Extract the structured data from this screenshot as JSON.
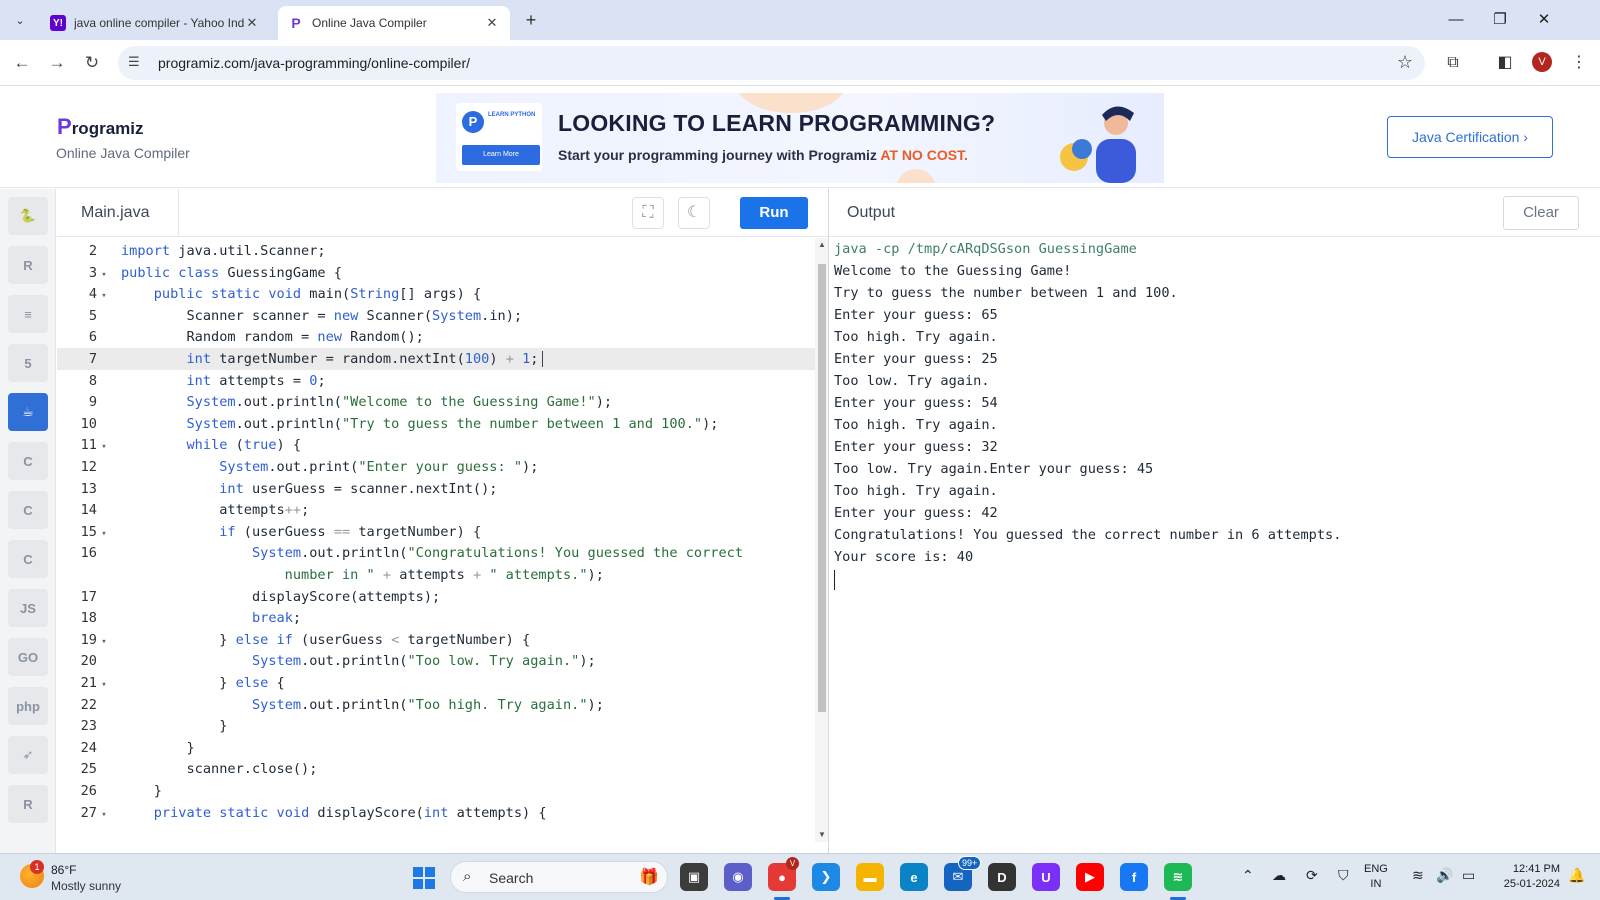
{
  "browser": {
    "tabs": [
      {
        "title": "java online compiler - Yahoo Ind",
        "favicon": "Y!",
        "favicon_color": "#6001d2",
        "close": "✕"
      },
      {
        "title": "Online Java Compiler",
        "favicon": "P",
        "favicon_color": "#ffffff",
        "close": "✕"
      }
    ],
    "tab_dropdown_icon": "⌄",
    "new_tab_icon": "+",
    "window_controls": {
      "minimize": "—",
      "maximize": "❐",
      "close": "✕"
    },
    "nav": {
      "back": "←",
      "forward": "→",
      "reload": "↻"
    },
    "url": "programiz.com/java-programming/online-compiler/",
    "site_info_icon": "☰",
    "bookmark_icon": "☆",
    "extensions_icon": "⧉",
    "sidepanel_icon": "◧",
    "profile_initial": "V",
    "menu_icon": "⋮"
  },
  "site": {
    "logo_text": "rogramiz",
    "logo_p": "P",
    "subtitle": "Online Java Compiler",
    "ad": {
      "card_label": "LEARN PYTHON",
      "card_button": "Learn More",
      "headline": "LOOKING TO LEARN PROGRAMMING?",
      "subline": "Start your programming journey with Programiz ",
      "subline_highlight": "AT NO COST."
    },
    "certification_button": "Java Certification ›"
  },
  "rail": [
    {
      "name": "python",
      "glyph": "🐍",
      "active": false
    },
    {
      "name": "r",
      "glyph": "R",
      "active": false
    },
    {
      "name": "sql",
      "glyph": "≡",
      "active": false
    },
    {
      "name": "html",
      "glyph": "5",
      "active": false
    },
    {
      "name": "java",
      "glyph": "☕",
      "active": true
    },
    {
      "name": "c",
      "glyph": "C",
      "active": false
    },
    {
      "name": "cpp",
      "glyph": "C",
      "active": false
    },
    {
      "name": "csharp",
      "glyph": "C",
      "active": false
    },
    {
      "name": "js",
      "glyph": "JS",
      "active": false
    },
    {
      "name": "go",
      "glyph": "GO",
      "active": false
    },
    {
      "name": "php",
      "glyph": "php",
      "active": false
    },
    {
      "name": "swift",
      "glyph": "➶",
      "active": false
    },
    {
      "name": "rust",
      "glyph": "R",
      "active": false
    }
  ],
  "editor": {
    "file_tab": "Main.java",
    "fullscreen_icon": "⛶",
    "theme_icon": "☾",
    "run_label": "Run",
    "highlighted_line": 7,
    "lines": [
      {
        "n": "2",
        "fold": "",
        "html": "<span class=\"kw\">import</span> java.util.Scanner;"
      },
      {
        "n": "3",
        "fold": "▾",
        "html": "<span class=\"kw\">public class</span> GuessingGame {"
      },
      {
        "n": "4",
        "fold": "▾",
        "html": "    <span class=\"kw\">public static void</span> main(<span class=\"kw\">String</span>[] args) {"
      },
      {
        "n": "5",
        "fold": "",
        "html": "        Scanner scanner = <span class=\"kw\">new</span> Scanner(<span class=\"kw\">System</span>.in);"
      },
      {
        "n": "6",
        "fold": "",
        "html": "        Random random = <span class=\"kw\">new</span> Random();"
      },
      {
        "n": "7",
        "fold": "",
        "html": "        <span class=\"kw\">int</span> targetNumber = random.nextInt(<span class=\"num\">100</span>) <span class=\"op\">+</span> <span class=\"num\">1</span>;"
      },
      {
        "n": "8",
        "fold": "",
        "html": "        <span class=\"kw\">int</span> attempts = <span class=\"num\">0</span>;"
      },
      {
        "n": "9",
        "fold": "",
        "html": "        <span class=\"kw\">System</span>.out.println(<span class=\"str\">\"Welcome to the Guessing Game!\"</span>);"
      },
      {
        "n": "10",
        "fold": "",
        "html": "        <span class=\"kw\">System</span>.out.println(<span class=\"str\">\"Try to guess the number between 1 and 100.\"</span>);"
      },
      {
        "n": "11",
        "fold": "▾",
        "html": "        <span class=\"kw\">while</span> (<span class=\"kw\">true</span>) {"
      },
      {
        "n": "12",
        "fold": "",
        "html": "            <span class=\"kw\">System</span>.out.print(<span class=\"str\">\"Enter your guess: \"</span>);"
      },
      {
        "n": "13",
        "fold": "",
        "html": "            <span class=\"kw\">int</span> userGuess = scanner.nextInt();"
      },
      {
        "n": "14",
        "fold": "",
        "html": "            attempts<span class=\"op\">++</span>;"
      },
      {
        "n": "15",
        "fold": "▾",
        "html": "            <span class=\"kw\">if</span> (userGuess <span class=\"op\">==</span> targetNumber) {"
      },
      {
        "n": "16",
        "fold": "",
        "html": "                <span class=\"kw\">System</span>.out.println(<span class=\"str\">\"Congratulations! You guessed the correct</span>"
      },
      {
        "n": "",
        "fold": "",
        "html": "<span class=\"str\">                    number in \"</span> <span class=\"op\">+</span> attempts <span class=\"op\">+</span> <span class=\"str\">\" attempts.\"</span>);"
      },
      {
        "n": "17",
        "fold": "",
        "html": "                displayScore(attempts);"
      },
      {
        "n": "18",
        "fold": "",
        "html": "                <span class=\"kw\">break</span>;"
      },
      {
        "n": "19",
        "fold": "▾",
        "html": "            } <span class=\"kw\">else if</span> (userGuess <span class=\"op\">&lt;</span> targetNumber) {"
      },
      {
        "n": "20",
        "fold": "",
        "html": "                <span class=\"kw\">System</span>.out.println(<span class=\"str\">\"Too low. Try again.\"</span>);"
      },
      {
        "n": "21",
        "fold": "▾",
        "html": "            } <span class=\"kw\">else</span> {"
      },
      {
        "n": "22",
        "fold": "",
        "html": "                <span class=\"kw\">System</span>.out.println(<span class=\"str\">\"Too high. Try again.\"</span>);"
      },
      {
        "n": "23",
        "fold": "",
        "html": "            }"
      },
      {
        "n": "24",
        "fold": "",
        "html": "        }"
      },
      {
        "n": "25",
        "fold": "",
        "html": "        scanner.close();"
      },
      {
        "n": "26",
        "fold": "",
        "html": "    }"
      },
      {
        "n": "27",
        "fold": "▾",
        "html": "    <span class=\"kw\">private static void</span> displayScore(<span class=\"kw\">int</span> attempts) {"
      }
    ]
  },
  "output": {
    "title": "Output",
    "clear_label": "Clear",
    "command": "java -cp /tmp/cARqDSGson GuessingGame",
    "lines": [
      "Welcome to the Guessing Game!",
      "Try to guess the number between 1 and 100.",
      "Enter your guess: 65",
      "Too high. Try again.",
      "Enter your guess: 25",
      "Too low. Try again.",
      "Enter your guess: 54",
      "Too high. Try again.",
      "Enter your guess: 32",
      "Too low. Try again.Enter your guess: 45",
      "Too high. Try again.",
      "Enter your guess: 42",
      "Congratulations! You guessed the correct number in 6 attempts.",
      "Your score is: 40"
    ]
  },
  "taskbar": {
    "weather_badge": "1",
    "temperature": "86°F",
    "weather": "Mostly sunny",
    "search_icon": "⌕",
    "search_label": "Search",
    "search_deco": "🎁",
    "apps": [
      {
        "name": "task-view",
        "glyph": "▣",
        "color": "#3c3c3c"
      },
      {
        "name": "teams",
        "glyph": "◉",
        "color": "#5b5fc7"
      },
      {
        "name": "chrome",
        "glyph": "●",
        "color": "#e53935"
      },
      {
        "name": "vscode",
        "glyph": "❯",
        "color": "#1e88e5"
      },
      {
        "name": "file-explorer",
        "glyph": "▬",
        "color": "#f4b400"
      },
      {
        "name": "edge",
        "glyph": "e",
        "color": "#0a84c6"
      },
      {
        "name": "mail",
        "glyph": "✉",
        "color": "#1565c0"
      },
      {
        "name": "dell",
        "glyph": "D",
        "color": "#333333"
      },
      {
        "name": "u-app",
        "glyph": "U",
        "color": "#7b2ff7"
      },
      {
        "name": "youtube",
        "glyph": "▶",
        "color": "#ff0000"
      },
      {
        "name": "facebook",
        "glyph": "f",
        "color": "#1877f2"
      },
      {
        "name": "spotify",
        "glyph": "≋",
        "color": "#1db954"
      }
    ],
    "mail_badge": "99+",
    "chrome_badge": "V",
    "tray": {
      "chevron": "⌃",
      "cloud": "☁",
      "sync": "⟳",
      "security": "⛉",
      "wifi": "≋",
      "volume": "🔊",
      "battery": "▭",
      "bell": "🔔"
    },
    "lang_line1": "ENG",
    "lang_line2": "IN",
    "time": "12:41 PM",
    "date": "25-01-2024"
  }
}
